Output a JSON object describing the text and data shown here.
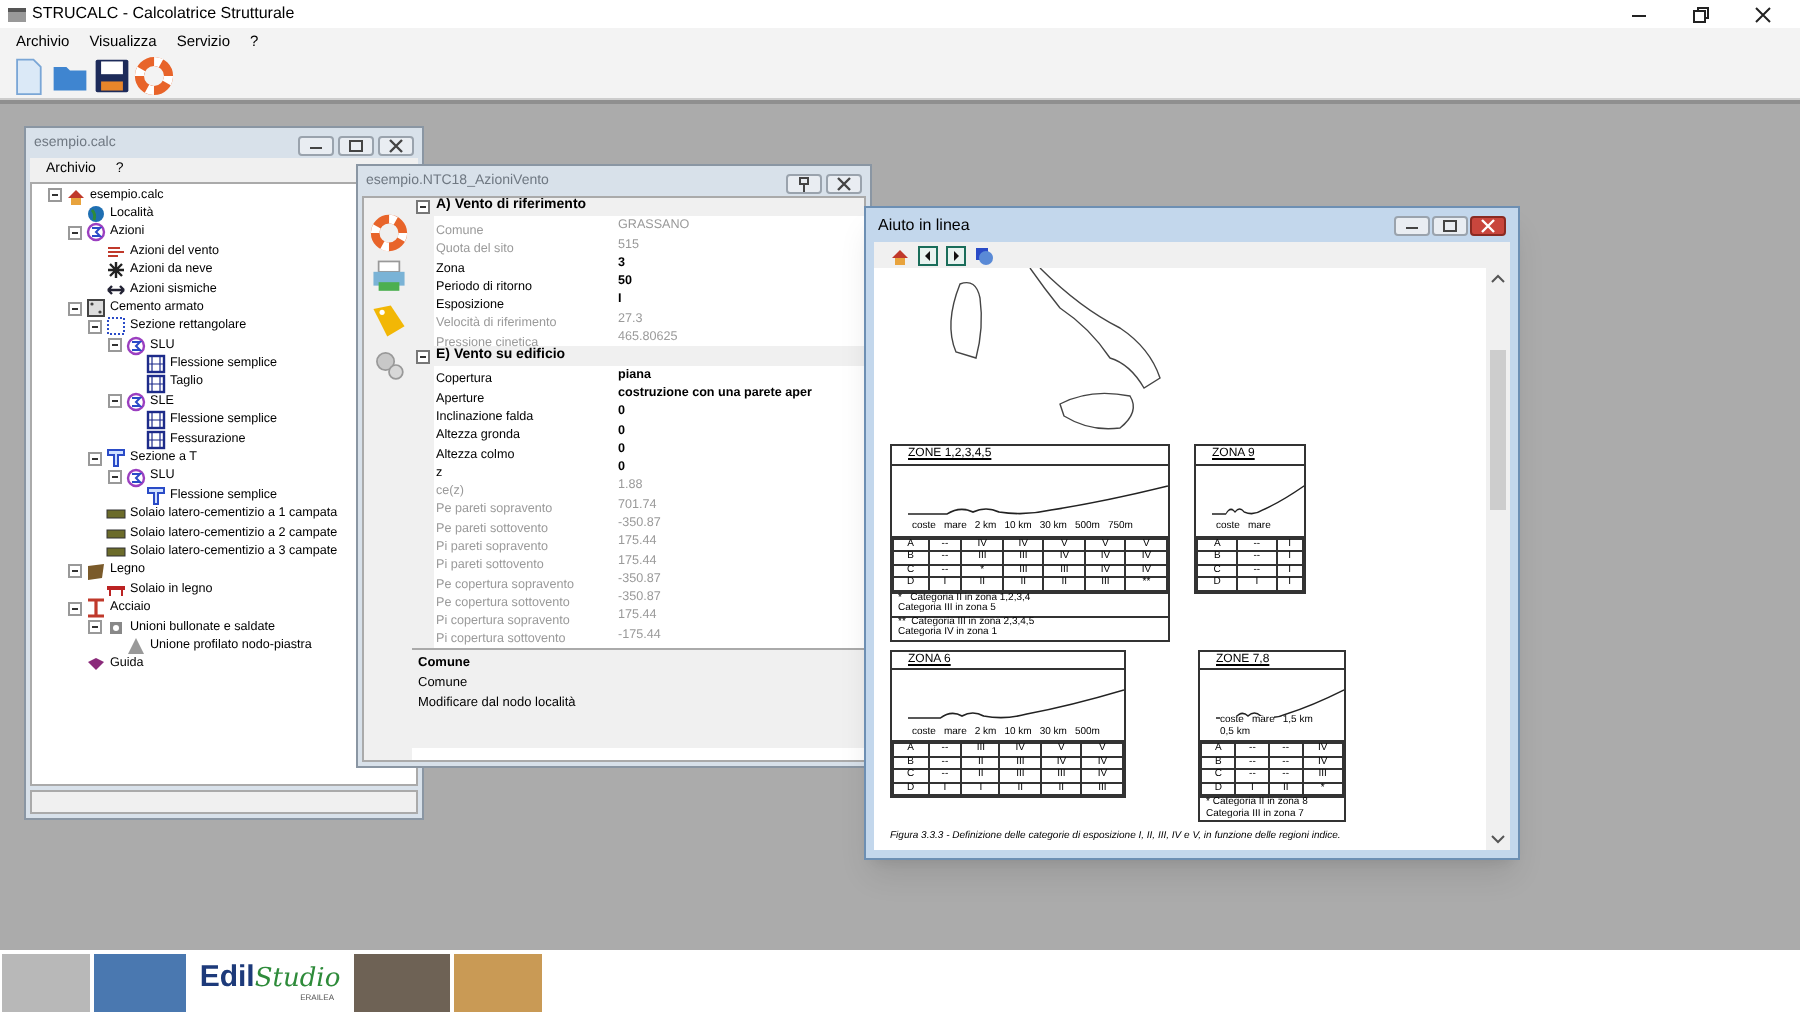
{
  "window": {
    "title": "STRUCALC - Calcolatrice Strutturale"
  },
  "menu": [
    "Archivio",
    "Visualizza",
    "Servizio",
    "?"
  ],
  "toolbar": [
    {
      "kind": "new"
    },
    {
      "kind": "open"
    },
    {
      "kind": "save"
    },
    {
      "kind": "help"
    }
  ],
  "project_window": {
    "title": "esempio.calc",
    "menu": [
      "Archivio",
      "?"
    ],
    "tree": [
      {
        "label": "esempio.calc",
        "kind": "home",
        "expanded": true,
        "children": [
          {
            "label": "Località",
            "kind": "globe"
          },
          {
            "label": "Azioni",
            "kind": "action",
            "expanded": true,
            "children": [
              {
                "label": "Azioni del vento",
                "kind": "wind"
              },
              {
                "label": "Azioni da neve",
                "kind": "snow"
              },
              {
                "label": "Azioni sismiche",
                "kind": "quake"
              }
            ]
          },
          {
            "label": "Cemento armato",
            "kind": "concrete",
            "expanded": true,
            "children": [
              {
                "label": "Sezione rettangolare",
                "kind": "rect",
                "expanded": true,
                "children": [
                  {
                    "label": "SLU",
                    "kind": "action",
                    "expanded": true,
                    "children": [
                      {
                        "label": "Flessione semplice",
                        "kind": "beam"
                      },
                      {
                        "label": "Taglio",
                        "kind": "beam"
                      }
                    ]
                  },
                  {
                    "label": "SLE",
                    "kind": "action",
                    "expanded": true,
                    "children": [
                      {
                        "label": "Flessione semplice",
                        "kind": "beam"
                      },
                      {
                        "label": "Fessurazione",
                        "kind": "beam"
                      }
                    ]
                  }
                ]
              },
              {
                "label": "Sezione a T",
                "kind": "tsec",
                "expanded": true,
                "children": [
                  {
                    "label": "SLU",
                    "kind": "action",
                    "expanded": true,
                    "children": [
                      {
                        "label": "Flessione semplice",
                        "kind": "tsec"
                      }
                    ]
                  }
                ]
              },
              {
                "label": "Solaio latero-cementizio a 1 campata",
                "kind": "slab"
              },
              {
                "label": "Solaio latero-cementizio a 2 campate",
                "kind": "slab"
              },
              {
                "label": "Solaio latero-cementizio a 3 campate",
                "kind": "slab"
              }
            ]
          },
          {
            "label": "Legno",
            "kind": "wood",
            "expanded": true,
            "children": [
              {
                "label": "Solaio in legno",
                "kind": "woodslab"
              }
            ]
          },
          {
            "label": "Acciaio",
            "kind": "steel",
            "expanded": true,
            "children": [
              {
                "label": "Unioni bullonate e saldate",
                "kind": "bolt",
                "expanded": true,
                "children": [
                  {
                    "label": "Unione profilato nodo-piastra",
                    "kind": "plate"
                  }
                ]
              }
            ]
          },
          {
            "label": "Guida",
            "kind": "guide"
          }
        ]
      }
    ]
  },
  "properties_window": {
    "title": "esempio.NTC18_AzioniVento",
    "side_tools": [
      {
        "kind": "help"
      },
      {
        "kind": "print"
      },
      {
        "kind": "tag"
      },
      {
        "kind": "gears"
      }
    ],
    "sections": [
      {
        "title": "A) Vento di riferimento",
        "expanded": true,
        "rows": [
          {
            "name": "Comune",
            "value": "GRASSANO",
            "readonly": true
          },
          {
            "name": "Quota del sito",
            "value": "515",
            "readonly": true
          },
          {
            "name": "Zona",
            "value": "3",
            "readonly": false
          },
          {
            "name": "Periodo di ritorno",
            "value": "50",
            "readonly": false
          },
          {
            "name": "Esposizione",
            "value": "I",
            "readonly": false
          },
          {
            "name": "Velocità di riferimento",
            "value": "27.3",
            "readonly": true
          },
          {
            "name": "Pressione cinetica",
            "value": "465.80625",
            "readonly": true
          }
        ]
      },
      {
        "title": "E) Vento su edificio",
        "expanded": true,
        "rows": [
          {
            "name": "Copertura",
            "value": "piana",
            "readonly": false
          },
          {
            "name": "Aperture",
            "value": "costruzione con una parete aper",
            "readonly": false
          },
          {
            "name": "Inclinazione falda",
            "value": "0",
            "readonly": false
          },
          {
            "name": "Altezza gronda",
            "value": "0",
            "readonly": false
          },
          {
            "name": "Altezza colmo",
            "value": "0",
            "readonly": false
          },
          {
            "name": "z",
            "value": "0",
            "readonly": false
          },
          {
            "name": "ce(z)",
            "value": "1.88",
            "readonly": true
          },
          {
            "name": "Pe pareti sopravento",
            "value": "701.74",
            "readonly": true
          },
          {
            "name": "Pe pareti sottovento",
            "value": "-350.87",
            "readonly": true
          },
          {
            "name": "Pi pareti sopravento",
            "value": "175.44",
            "readonly": true
          },
          {
            "name": "Pi pareti sottovento",
            "value": "175.44",
            "readonly": true
          },
          {
            "name": "Pe copertura sopravento",
            "value": "-350.87",
            "readonly": true
          },
          {
            "name": "Pe copertura sottovento",
            "value": "-350.87",
            "readonly": true
          },
          {
            "name": "Pi copertura sopravento",
            "value": "175.44",
            "readonly": true
          },
          {
            "name": "Pi copertura sottovento",
            "value": "-175.44",
            "readonly": true
          }
        ]
      }
    ],
    "description": {
      "title": "Comune",
      "lines": [
        "Comune",
        "Modificare dal nodo località"
      ]
    }
  },
  "help_window": {
    "title": "Aiuto in linea",
    "toolbar": [
      {
        "kind": "home"
      },
      {
        "kind": "back"
      },
      {
        "kind": "forward"
      },
      {
        "kind": "globe"
      }
    ],
    "zones": [
      {
        "title": "ZONE 1,2,3,4,5",
        "labels": [
          "coste",
          "mare",
          "2 km",
          "10 km",
          "30 km",
          "500m",
          "750m"
        ],
        "rows": [
          [
            "A",
            "--",
            "IV",
            "IV",
            "V",
            "V",
            "V"
          ],
          [
            "B",
            "--",
            "III",
            "III",
            "IV",
            "IV",
            "IV"
          ],
          [
            "C",
            "--",
            "*",
            "III",
            "III",
            "IV",
            "IV"
          ],
          [
            "D",
            "I",
            "II",
            "II",
            "II",
            "III",
            "**"
          ]
        ],
        "notes": [
          "*   Categoria II in zona 1,2,3,4\nCategoria III in zona 5",
          "**  Categoria III in zona 2,3,4,5\nCategoria IV in zona 1"
        ]
      },
      {
        "title": "ZONA 9",
        "labels": [
          "coste",
          "mare"
        ],
        "rows": [
          [
            "A",
            "--",
            "I"
          ],
          [
            "B",
            "--",
            "I"
          ],
          [
            "C",
            "--",
            "I"
          ],
          [
            "D",
            "I",
            "I"
          ]
        ]
      },
      {
        "title": "ZONA 6",
        "labels": [
          "coste",
          "mare",
          "2 km",
          "10 km",
          "30 km",
          "500m"
        ],
        "rows": [
          [
            "A",
            "--",
            "III",
            "IV",
            "V",
            "V"
          ],
          [
            "B",
            "--",
            "II",
            "III",
            "IV",
            "IV"
          ],
          [
            "C",
            "--",
            "II",
            "III",
            "III",
            "IV"
          ],
          [
            "D",
            "I",
            "I",
            "II",
            "II",
            "III"
          ]
        ]
      },
      {
        "title": "ZONE 7,8",
        "labels": [
          "coste",
          "mare",
          "1,5 km",
          "0,5 km"
        ],
        "rows": [
          [
            "A",
            "--",
            "--",
            "IV"
          ],
          [
            "B",
            "--",
            "--",
            "IV"
          ],
          [
            "C",
            "--",
            "--",
            "III"
          ],
          [
            "D",
            "I",
            "II",
            "*"
          ]
        ],
        "notes": [
          "* Categoria II in zona 8\nCategoria III in zona 7"
        ]
      }
    ],
    "caption": "Figura 3.3.3 - Definizione delle categorie di esposizione I, II, III, IV e V, in funzione delle regioni indice."
  },
  "banner": {
    "logo_main": "Edil",
    "logo_script": "Studio",
    "logo_sub": "ERAILEA"
  }
}
